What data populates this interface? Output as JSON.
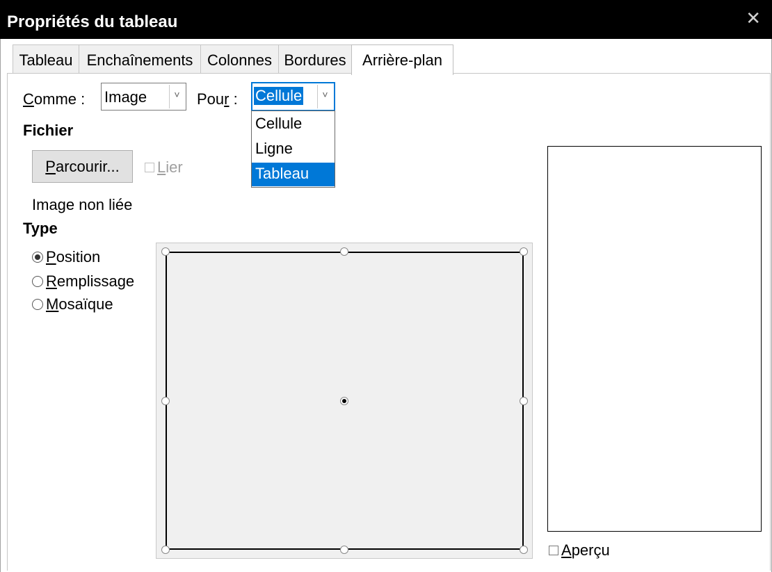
{
  "window": {
    "title": "Propriétés du tableau",
    "close_glyph": "✕"
  },
  "tabs": [
    {
      "label": "Tableau",
      "active": false
    },
    {
      "label": "Enchaînements",
      "active": false
    },
    {
      "label": "Colonnes",
      "active": false
    },
    {
      "label": "Bordures",
      "active": false
    },
    {
      "label": "Arrière-plan",
      "active": true
    }
  ],
  "background": {
    "as_label_mnemonic": "C",
    "as_label_rest": "omme :",
    "as_value": "Image",
    "for_label_pre": "Pou",
    "for_label_mnemonic": "r",
    "for_label_post": " :",
    "for_value": "Cellule",
    "for_options": [
      {
        "label": "Cellule",
        "selected": false
      },
      {
        "label": "Ligne",
        "selected": false
      },
      {
        "label": "Tableau",
        "selected": true
      }
    ],
    "arrow_glyph": "˅"
  },
  "file": {
    "heading": "Fichier",
    "browse_mnemonic": "P",
    "browse_rest": "arcourir...",
    "link_mnemonic": "L",
    "link_rest": "ier",
    "link_checked": false,
    "status": "Image non liée"
  },
  "type": {
    "heading": "Type",
    "options": [
      {
        "mnemonic": "P",
        "rest": "osition",
        "checked": true
      },
      {
        "mnemonic": "R",
        "rest": "emplissage",
        "checked": false
      },
      {
        "mnemonic": "M",
        "rest": "osaïque",
        "checked": false
      }
    ],
    "selected_position": "middle-center"
  },
  "preview": {
    "mnemonic": "A",
    "rest": "perçu",
    "checked": false
  }
}
